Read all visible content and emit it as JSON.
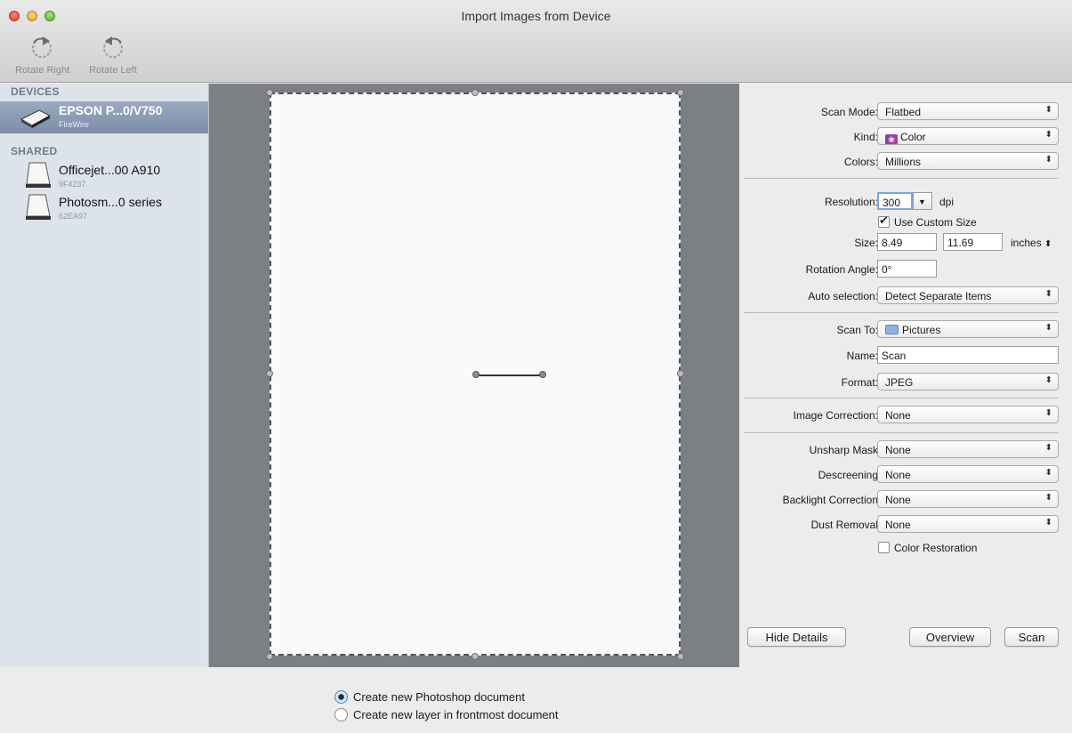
{
  "window": {
    "title": "Import Images from Device"
  },
  "toolbar": {
    "rotate_right": "Rotate Right",
    "rotate_left": "Rotate Left"
  },
  "sidebar": {
    "devices_header": "DEVICES",
    "devices": [
      {
        "name": "EPSON P...0/V750",
        "sub": "FireWire",
        "selected": true
      }
    ],
    "shared_header": "SHARED",
    "shared": [
      {
        "name": "Officejet...00 A910",
        "sub": "9F4237"
      },
      {
        "name": "Photosm...0 series",
        "sub": "62EA97"
      }
    ]
  },
  "settings": {
    "scan_mode": {
      "label": "Scan Mode:",
      "value": "Flatbed"
    },
    "kind": {
      "label": "Kind:",
      "value": "Color"
    },
    "colors": {
      "label": "Colors:",
      "value": "Millions"
    },
    "resolution": {
      "label": "Resolution:",
      "value": "300",
      "unit": "dpi"
    },
    "use_custom_size": {
      "label": "Use Custom Size",
      "checked": true
    },
    "size": {
      "label": "Size:",
      "width": "8.49",
      "height": "11.69",
      "unit": "inches"
    },
    "rotation": {
      "label": "Rotation Angle:",
      "value": "0°"
    },
    "auto_selection": {
      "label": "Auto selection:",
      "value": "Detect Separate Items"
    },
    "scan_to": {
      "label": "Scan To:",
      "value": "Pictures"
    },
    "name": {
      "label": "Name:",
      "value": "Scan"
    },
    "format": {
      "label": "Format:",
      "value": "JPEG"
    },
    "image_correction": {
      "label": "Image Correction:",
      "value": "None"
    },
    "unsharp_mask": {
      "label": "Unsharp Mask",
      "value": "None"
    },
    "descreening": {
      "label": "Descreening",
      "value": "None"
    },
    "backlight": {
      "label": "Backlight Correction",
      "value": "None"
    },
    "dust_removal": {
      "label": "Dust Removal",
      "value": "None"
    },
    "color_restoration": {
      "label": "Color Restoration",
      "checked": false
    }
  },
  "buttons": {
    "hide_details": "Hide Details",
    "overview": "Overview",
    "scan": "Scan"
  },
  "bottom": {
    "options": [
      {
        "label": "Create new Photoshop document",
        "selected": true
      },
      {
        "label": "Create new layer in frontmost document",
        "selected": false
      }
    ]
  },
  "colors": {
    "accent": "#4a7fc7",
    "sidebar_bg": "#dde3ea",
    "selected_row": "#8a9ab3",
    "preview_bg": "#7c7f83"
  }
}
